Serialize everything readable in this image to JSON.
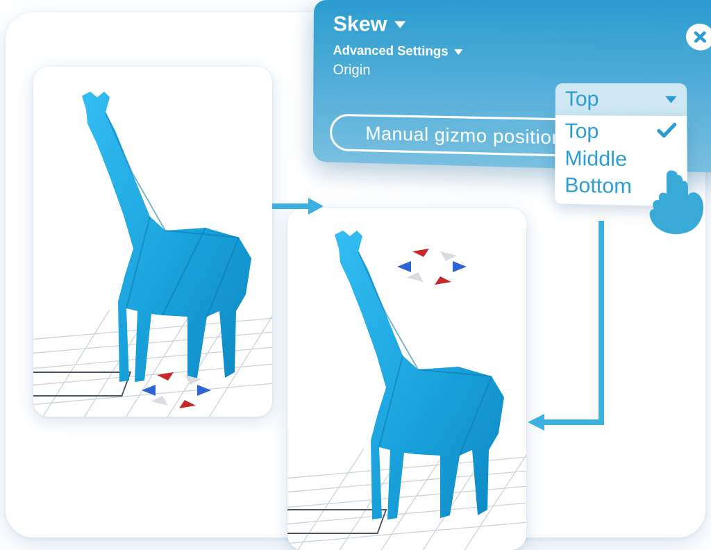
{
  "panel": {
    "title": "Skew",
    "subtitle": "Advanced Settings",
    "origin_label": "Origin",
    "button_label": "Manual gizmo position"
  },
  "dropdown": {
    "selected": "Top",
    "options": [
      "Top",
      "Middle",
      "Bottom"
    ]
  },
  "icons": {
    "close": "close-icon",
    "caret": "chevron-down-icon",
    "check": "check-icon",
    "hand": "pointer-hand-icon"
  },
  "thumbnails": {
    "left_caption": "origin-bottom-preview",
    "right_caption": "origin-top-preview"
  }
}
